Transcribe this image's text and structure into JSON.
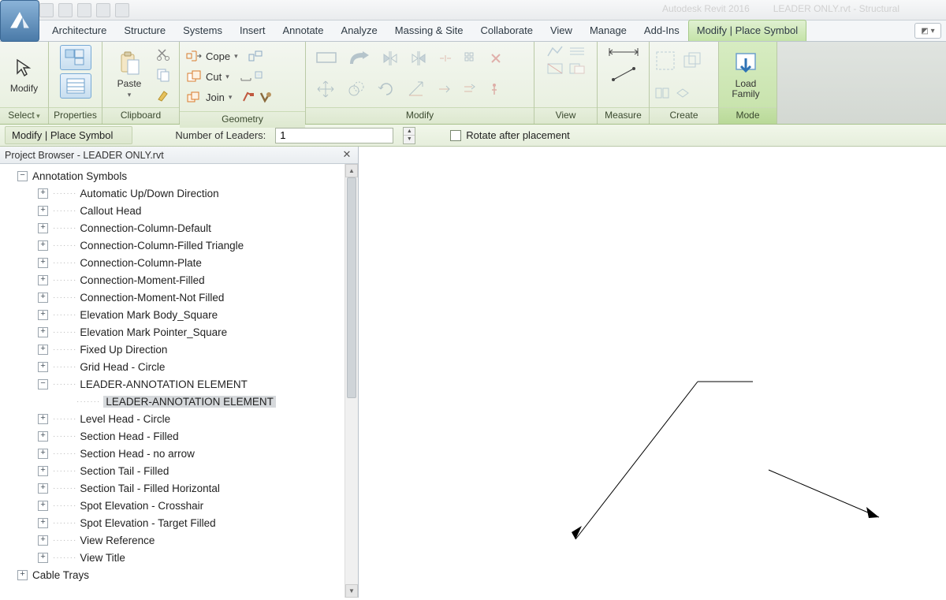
{
  "title_bar": {
    "app": "Autodesk Revit 2016",
    "doc": "LEADER ONLY.rvt - Structural"
  },
  "menu_tabs": [
    "Architecture",
    "Structure",
    "Systems",
    "Insert",
    "Annotate",
    "Analyze",
    "Massing & Site",
    "Collaborate",
    "View",
    "Manage",
    "Add-Ins",
    "Modify | Place Symbol"
  ],
  "active_menu_tab": 11,
  "ribbon": {
    "select": {
      "modify": "Modify",
      "title": "Select"
    },
    "properties": {
      "title": "Properties"
    },
    "clipboard": {
      "paste": "Paste",
      "title": "Clipboard"
    },
    "geometry": {
      "cope": "Cope",
      "cut": "Cut",
      "join": "Join",
      "title": "Geometry"
    },
    "modify": {
      "title": "Modify"
    },
    "view": {
      "title": "View"
    },
    "measure": {
      "title": "Measure"
    },
    "create": {
      "title": "Create"
    },
    "mode": {
      "load": "Load\nFamily",
      "title": "Mode"
    }
  },
  "options": {
    "context": "Modify | Place Symbol",
    "leaders_label": "Number of Leaders:",
    "leaders_value": "1",
    "rotate": "Rotate after placement"
  },
  "browser": {
    "title": "Project Browser - LEADER ONLY.rvt",
    "root": "Annotation Symbols",
    "items": [
      {
        "label": "Automatic Up/Down Direction",
        "exp": "+"
      },
      {
        "label": "Callout Head",
        "exp": "+"
      },
      {
        "label": "Connection-Column-Default",
        "exp": "+"
      },
      {
        "label": "Connection-Column-Filled Triangle",
        "exp": "+"
      },
      {
        "label": "Connection-Column-Plate",
        "exp": "+"
      },
      {
        "label": "Connection-Moment-Filled",
        "exp": "+"
      },
      {
        "label": "Connection-Moment-Not Filled",
        "exp": "+"
      },
      {
        "label": "Elevation Mark Body_Square",
        "exp": "+"
      },
      {
        "label": "Elevation Mark Pointer_Square",
        "exp": "+"
      },
      {
        "label": "Fixed Up Direction",
        "exp": "+"
      },
      {
        "label": "Grid Head - Circle",
        "exp": "+"
      },
      {
        "label": "LEADER-ANNOTATION ELEMENT",
        "exp": "-",
        "children": [
          {
            "label": "LEADER-ANNOTATION ELEMENT",
            "selected": true
          }
        ]
      },
      {
        "label": "Level Head - Circle",
        "exp": "+"
      },
      {
        "label": "Section Head - Filled",
        "exp": "+"
      },
      {
        "label": "Section Head - no arrow",
        "exp": "+"
      },
      {
        "label": "Section Tail - Filled",
        "exp": "+"
      },
      {
        "label": "Section Tail - Filled Horizontal",
        "exp": "+"
      },
      {
        "label": "Spot Elevation - Crosshair",
        "exp": "+"
      },
      {
        "label": "Spot Elevation - Target Filled",
        "exp": "+"
      },
      {
        "label": "View Reference",
        "exp": "+"
      },
      {
        "label": "View Title",
        "exp": "+"
      }
    ],
    "after": "Cable Trays"
  }
}
